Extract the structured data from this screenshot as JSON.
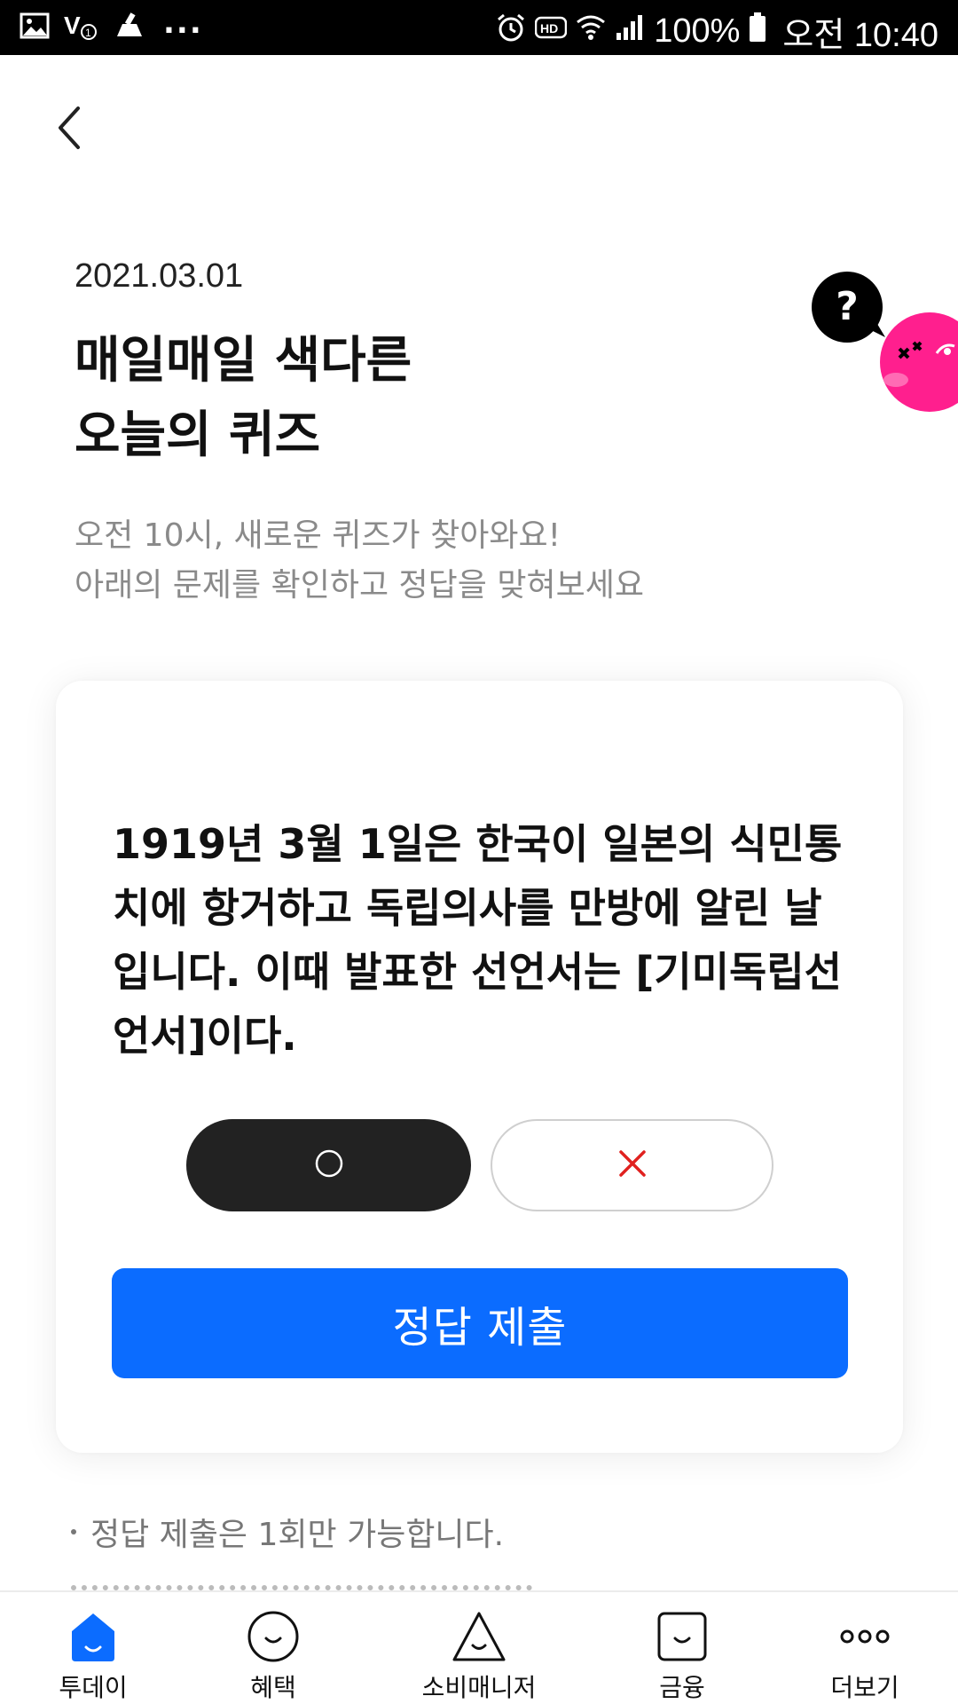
{
  "status_bar": {
    "battery_percent": "100%",
    "time": "오전 10:40",
    "overflow": "...",
    "left_icons": [
      "image-icon",
      "volte-icon",
      "cleaner-icon"
    ],
    "right_icons": [
      "alarm-icon",
      "hd-icon",
      "wifi-icon",
      "signal-icon",
      "battery-icon"
    ]
  },
  "header": {
    "date": "2021.03.01",
    "title_line1": "매일매일 색다른",
    "title_line2": "오늘의 퀴즈",
    "subtitle_line1": "오전 10시, 새로운 퀴즈가 찾아와요!",
    "subtitle_line2": "아래의 문제를 확인하고 정답을 맞혀보세요"
  },
  "mascot": {
    "bubble_text": "?",
    "color": "#ff1f8e"
  },
  "quiz": {
    "question_line1": "1919년 3월 1일은 한국이 일본의 식민통",
    "question_line2": "치에 항거하고 독립의사를 만방에 알린 날",
    "question_line3": "입니다. 이때 발표한 선언서는 [기미독립선",
    "question_line4": "언서]이다.",
    "option_o_icon": "circle-icon",
    "option_x_icon": "x-icon",
    "selected": "O",
    "submit_label": "정답 제출"
  },
  "notice": {
    "line1": "정답 제출은 1회만 가능합니다."
  },
  "bottom_nav": {
    "items": [
      {
        "label": "투데이",
        "icon": "home-icon",
        "active": true
      },
      {
        "label": "혜택",
        "icon": "smile-circle-icon"
      },
      {
        "label": "소비매니저",
        "icon": "triangle-face-icon"
      },
      {
        "label": "금융",
        "icon": "square-face-icon"
      },
      {
        "label": "더보기",
        "icon": "more-icon"
      }
    ]
  },
  "colors": {
    "accent": "#0b6cff",
    "selected_fill": "#222222",
    "x_color": "#e0211f",
    "mascot": "#ff1f8e"
  }
}
